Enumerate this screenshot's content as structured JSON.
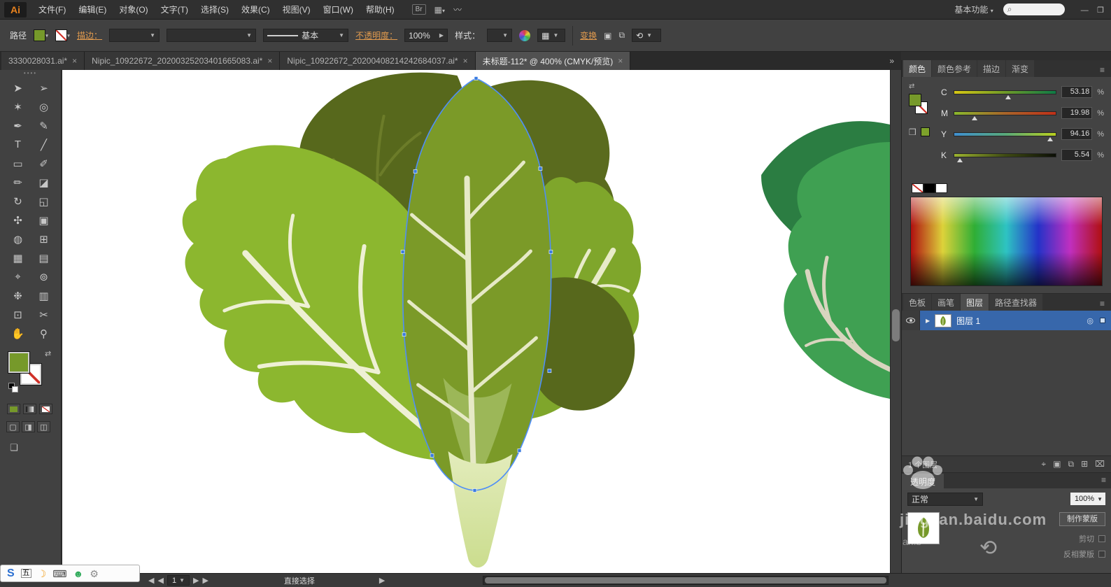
{
  "icons": {
    "close": "×",
    "caret": "▼",
    "caret_small": "▾",
    "search": "⌕",
    "overflow": "»",
    "minimize": "—",
    "restore": "❐",
    "menu": "≡",
    "target": "◎",
    "prev": "◀",
    "next": "▶",
    "expand": "▶",
    "swap": "⇄",
    "cube": "❒",
    "grip": "••••",
    "locate": "⌖",
    "clip_mask": "▣",
    "new_sublayer": "⧉",
    "new_layer": "⊞",
    "delete": "⌧",
    "link_arrows": "⟲",
    "grid": "▦",
    "wave": "〰",
    "draw_normal": "▢",
    "draw_behind": "◨",
    "draw_inside": "◫",
    "screen_mode": "❏"
  },
  "menubar": {
    "logo": "Ai",
    "menus": [
      "文件(F)",
      "编辑(E)",
      "对象(O)",
      "文字(T)",
      "选择(S)",
      "效果(C)",
      "视图(V)",
      "窗口(W)",
      "帮助(H)"
    ],
    "bridge_label": "Br",
    "workspace": "基本功能",
    "search_value": ""
  },
  "control_bar": {
    "object_label": "路径",
    "stroke_link": "描边：",
    "brush_name": "基本",
    "opacity_link": "不透明度：",
    "opacity_value": "100%",
    "style_label": "样式：",
    "transform_link": "变换"
  },
  "document_tabs": [
    {
      "label": "3330028031.ai*",
      "active": false
    },
    {
      "label": "Nipic_10922672_20200325203401665083.ai*",
      "active": false
    },
    {
      "label": "Nipic_10922672_20200408214242684037.ai*",
      "active": false
    },
    {
      "label": "未标题-112* @ 400% (CMYK/预览)",
      "active": true
    }
  ],
  "toolbar": {
    "tools": [
      {
        "name": "selection-tool",
        "glyph": "➤"
      },
      {
        "name": "direct-selection-tool",
        "glyph": "➢"
      },
      {
        "name": "magic-wand-tool",
        "glyph": "✶"
      },
      {
        "name": "lasso-tool",
        "glyph": "◎"
      },
      {
        "name": "pen-tool",
        "glyph": "✒"
      },
      {
        "name": "curvature-tool",
        "glyph": "✎"
      },
      {
        "name": "type-tool",
        "glyph": "T"
      },
      {
        "name": "line-segment-tool",
        "glyph": "╱"
      },
      {
        "name": "rectangle-tool",
        "glyph": "▭"
      },
      {
        "name": "paintbrush-tool",
        "glyph": "✐"
      },
      {
        "name": "pencil-tool",
        "glyph": "✏"
      },
      {
        "name": "eraser-tool",
        "glyph": "◪"
      },
      {
        "name": "rotate-tool",
        "glyph": "↻"
      },
      {
        "name": "scale-tool",
        "glyph": "◱"
      },
      {
        "name": "width-tool",
        "glyph": "✣"
      },
      {
        "name": "free-transform-tool",
        "glyph": "▣"
      },
      {
        "name": "shape-builder-tool",
        "glyph": "◍"
      },
      {
        "name": "perspective-grid-tool",
        "glyph": "⊞"
      },
      {
        "name": "mesh-tool",
        "glyph": "▦"
      },
      {
        "name": "gradient-tool",
        "glyph": "▤"
      },
      {
        "name": "eyedropper-tool",
        "glyph": "⌖"
      },
      {
        "name": "blend-tool",
        "glyph": "⊚"
      },
      {
        "name": "symbol-sprayer-tool",
        "glyph": "❉"
      },
      {
        "name": "column-graph-tool",
        "glyph": "▥"
      },
      {
        "name": "artboard-tool",
        "glyph": "⊡"
      },
      {
        "name": "slice-tool",
        "glyph": "✂"
      },
      {
        "name": "hand-tool",
        "glyph": "✋"
      },
      {
        "name": "zoom-tool",
        "glyph": "⚲"
      }
    ]
  },
  "color_panel": {
    "tabs": [
      {
        "label": "颜色",
        "name": "panel-tab-color",
        "active": true
      },
      {
        "label": "颜色参考",
        "name": "panel-tab-color-guide",
        "active": false
      },
      {
        "label": "描边",
        "name": "panel-tab-stroke",
        "active": false
      },
      {
        "label": "渐变",
        "name": "panel-tab-gradient",
        "active": false
      }
    ],
    "channels": [
      {
        "label": "C",
        "value": "53.18",
        "unit": "%"
      },
      {
        "label": "M",
        "value": "19.98",
        "unit": "%"
      },
      {
        "label": "Y",
        "value": "94.16",
        "unit": "%"
      },
      {
        "label": "K",
        "value": "5.54",
        "unit": "%"
      }
    ]
  },
  "panel_group_tabs": [
    {
      "label": "色板",
      "name": "panel-tab-swatches",
      "active": false
    },
    {
      "label": "画笔",
      "name": "panel-tab-brushes",
      "active": false
    },
    {
      "label": "图层",
      "name": "panel-tab-layers",
      "active": true
    },
    {
      "label": "路径查找器",
      "name": "panel-tab-pathfinder",
      "active": false
    }
  ],
  "layers_panel": {
    "layer_name": "图层 1",
    "count_text": "1 个图层"
  },
  "transparency_panel": {
    "title": "透明度",
    "blend_mode": "正常",
    "opacity": "100%",
    "make_mask_label": "制作蒙版",
    "clip_label": "剪切",
    "invert_label": "反相蒙版"
  },
  "status_bar": {
    "tool_name": "直接选择",
    "artboard_number": "1"
  },
  "ime": {
    "items": [
      {
        "name": "ime-logo-icon",
        "glyph": "S"
      },
      {
        "name": "ime-wubi-mode-icon",
        "glyph": "五"
      },
      {
        "name": "ime-halfmoon-icon",
        "glyph": "☽"
      },
      {
        "name": "ime-keyboard-icon",
        "glyph": "⌨"
      },
      {
        "name": "ime-user-icon",
        "glyph": "☻"
      },
      {
        "name": "ime-settings-icon",
        "glyph": "⚙"
      }
    ]
  },
  "watermark": {
    "text": "jingyan.baidu.com",
    "sub": "an.b"
  },
  "artwork_colors": {
    "leaf_dark": "#57681c",
    "leaf_mid": "#7b9a28",
    "leaf_bright_left": "#8cb72f",
    "leaf_bright_right": "#7fa62b",
    "vein": "#ece9cf",
    "stem_light": "#e3ecbc",
    "stem_dark": "#cbdd8e",
    "right_leaf_back": "#2b7d42",
    "right_leaf_front": "#3fa052",
    "selection_blue": "#4f8ef7"
  }
}
